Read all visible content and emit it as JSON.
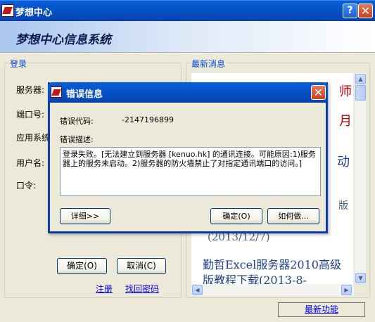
{
  "window": {
    "title": "梦想中心",
    "help_label": "?",
    "close_label": "✕",
    "banner_title": "梦想中心信息系统"
  },
  "login": {
    "group_label": "登录",
    "labels": [
      "服务器:",
      "端口号:",
      "应用系统",
      "用户名:",
      "口令:"
    ],
    "ok_button": "确定(O)",
    "cancel_button": "取消(C)",
    "register_link": "注册",
    "recover_link": "找回密码"
  },
  "news": {
    "group_label": "最新消息",
    "partial_chars": [
      "师",
      "月",
      "动",
      "版"
    ],
    "date_fragment": "(2013/12/7)",
    "item": "勤哲Excel服务器2010高级版教程下载(2013-8-"
  },
  "status": {
    "latest_features": "最新功能"
  },
  "dialog": {
    "title": "错误信息",
    "close_label": "✕",
    "error_code_label": "错误代码:",
    "error_code_value": "-2147196899",
    "error_desc_label": "错误描述:",
    "error_desc": "登录失败。[无法建立到服务器 [kenuo.hk] 的通讯连接。可能原因:1)服务器上的服务未启动。2)服务器的防火墙禁止了对指定通讯端口的访问。]",
    "details_button": "详细>>",
    "ok_button": "确定(O)",
    "howto_button": "如何做..."
  }
}
